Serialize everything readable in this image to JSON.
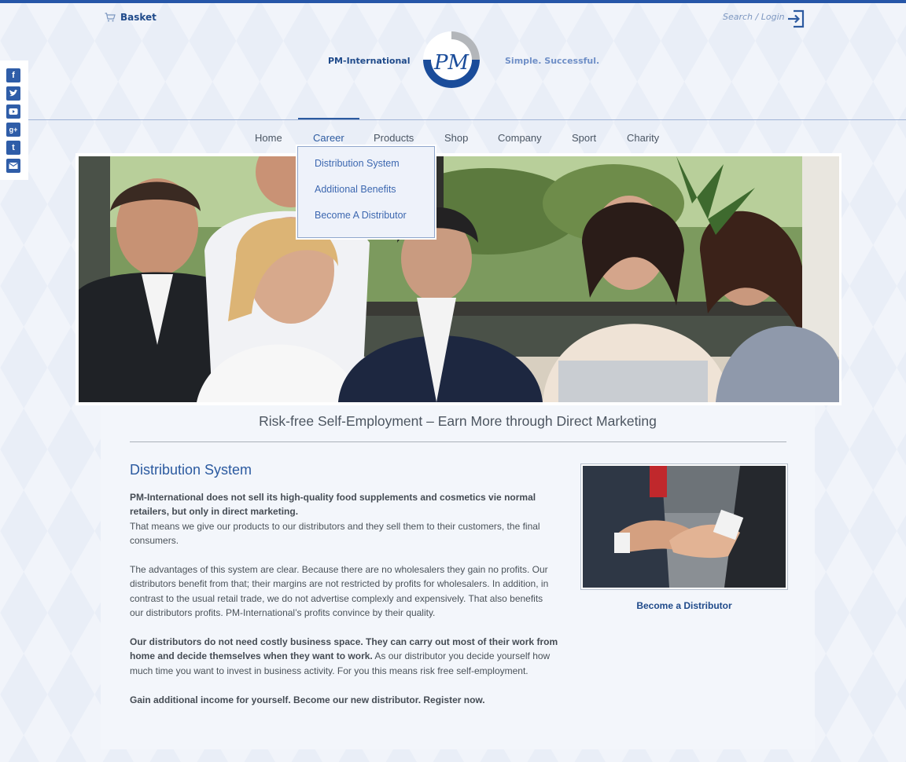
{
  "header": {
    "basket_label": "Basket",
    "search_login_label": "Search / Login",
    "brand_name": "PM-International",
    "slogan": "Simple. Successful.",
    "logo_letters": "PM"
  },
  "social": {
    "icons": [
      "facebook-icon",
      "twitter-icon",
      "youtube-icon",
      "googleplus-icon",
      "tumblr-icon",
      "email-icon"
    ]
  },
  "nav": {
    "items": [
      "Home",
      "Career",
      "Products",
      "Shop",
      "Company",
      "Sport",
      "Charity"
    ],
    "active": "Career"
  },
  "dropdown": {
    "items": [
      "Distribution System",
      "Additional Benefits",
      "Become A Distributor"
    ]
  },
  "content": {
    "headline": "Risk-free Self-Employment – Earn More through Direct Marketing",
    "section_title": "Distribution System",
    "p1_bold": "PM-International does not sell its high-quality food supplements and cosmetics vie normal retailers, but only in direct marketing.",
    "p1_rest": "That means we give our products to our distributors and they sell them to their customers, the final consumers.",
    "p2": "The advantages of this system are clear. Because there are no wholesalers they gain no profits. Our distributors benefit from that; their margins are not restricted by profits for wholesalers. In addition, in contrast to the usual retail trade, we do not advertise complexly and expensively. That also benefits our distributors profits. PM-International’s profits convince by their quality.",
    "p3_bold": "Our distributors do not need costly business space. They can carry out most of their work from home and decide themselves when they want to work.",
    "p3_rest": " As our distributor you decide yourself how much time you want to invest in business activity. For you this means risk free self-employment.",
    "p4_bold": "Gain additional income for yourself. Become our new distributor. Register now.",
    "side_caption": "Become a Distributor"
  },
  "colors": {
    "accent": "#2c5aa0",
    "topbar": "#2656a8",
    "page_bg": "#e9eef7"
  }
}
